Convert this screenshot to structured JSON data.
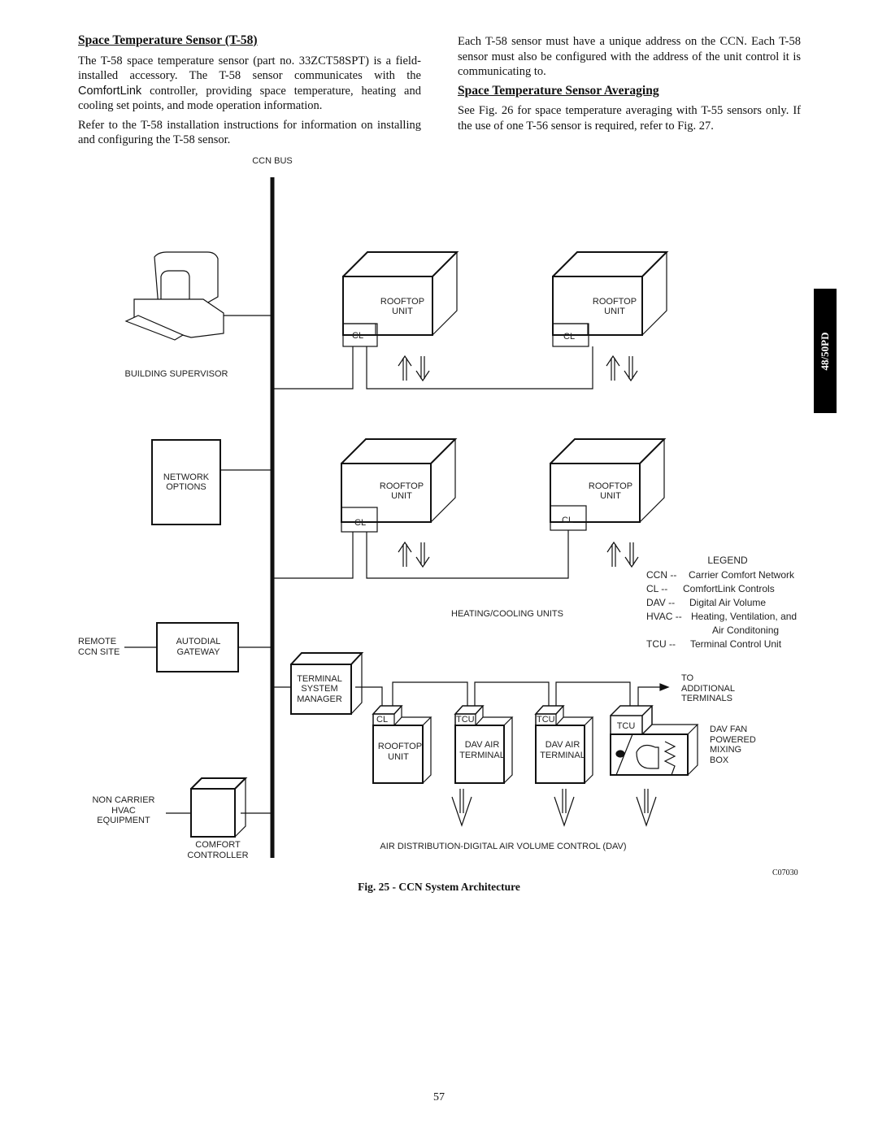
{
  "left_column": {
    "heading": "Space Temperature Sensor (T-58)",
    "para1_pre": "The T-58 space temperature sensor (part no. 33ZCT58SPT) is a field-installed accessory. The T-58 sensor communicates with the ",
    "para1_brand": "ComfortLink",
    "para1_post": " controller, providing space temperature, heating and cooling set points, and mode operation information.",
    "para2": "Refer to the T-58 installation instructions for information on installing and configuring the T-58 sensor."
  },
  "right_column": {
    "para1": "Each T-58 sensor must have a unique address on the CCN. Each T-58 sensor must also be configured with the address of the unit control it is communicating to.",
    "heading": "Space Temperature Sensor Averaging",
    "para2": "See Fig. 26 for space temperature averaging with T-55 sensors only. If the use of one T-56 sensor is required, refer to Fig. 27."
  },
  "side_tab": "48/50PD",
  "diagram": {
    "ccn_bus": "CCN BUS",
    "building_supervisor": "BUILDING SUPERVISOR",
    "network_options": [
      "NETWORK",
      "OPTIONS"
    ],
    "remote_site": [
      "REMOTE",
      "CCN SITE"
    ],
    "autodial": [
      "AUTODIAL",
      "GATEWAY"
    ],
    "non_carrier": [
      "NON CARRIER",
      "HVAC",
      "EQUIPMENT"
    ],
    "comfort_controller": [
      "COMFORT",
      "CONTROLLER"
    ],
    "rooftop_unit": [
      "ROOFTOP",
      "UNIT"
    ],
    "cl": "CL",
    "tcu": "TCU",
    "heating_cooling_units": "HEATING/COOLING UNITS",
    "terminal_system_manager": [
      "TERMINAL",
      "SYSTEM",
      "MANAGER"
    ],
    "dav_air_terminal": [
      "DAV AIR",
      "TERMINAL"
    ],
    "to_additional": [
      "TO",
      "ADDITIONAL",
      "TERMINALS"
    ],
    "dav_fan_box": [
      "DAV FAN",
      "POWERED",
      "MIXING",
      "BOX"
    ],
    "air_distribution": "AIR DISTRIBUTION-DIGITAL AIR VOLUME CONTROL (DAV)",
    "legend": {
      "title": "LEGEND",
      "items": [
        {
          "abbr": "CCN --",
          "text": "Carrier Comfort Network"
        },
        {
          "abbr": "CL   --",
          "text": "ComfortLink   Controls"
        },
        {
          "abbr": "DAV --",
          "text": "Digital Air Volume"
        },
        {
          "abbr": "HVAC --",
          "text": "Heating, Ventilation, and"
        },
        {
          "abbr": "",
          "text": "Air Conditoning"
        },
        {
          "abbr": "TCU --",
          "text": "Terminal Control Unit"
        }
      ]
    }
  },
  "figure_code": "C07030",
  "figure_caption": "Fig. 25 - CCN System Architecture",
  "page_number": "57"
}
